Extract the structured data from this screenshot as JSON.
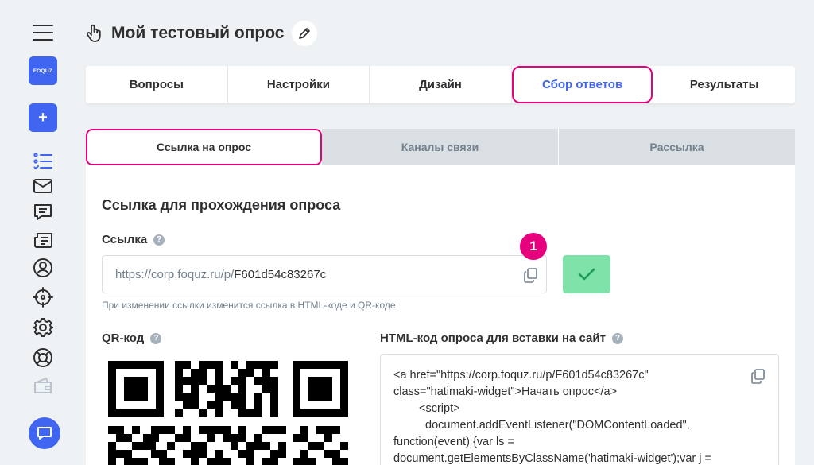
{
  "app": {
    "logo_text": "FOQUZ"
  },
  "sidebar": {
    "add_label": "+",
    "items": [
      {
        "icon": "checklist-icon"
      },
      {
        "icon": "mail-icon"
      },
      {
        "icon": "message-icon"
      },
      {
        "icon": "newspaper-icon"
      },
      {
        "icon": "user-icon"
      },
      {
        "icon": "target-icon"
      },
      {
        "icon": "gear-icon"
      },
      {
        "icon": "lifebuoy-icon"
      },
      {
        "icon": "wallet-icon"
      }
    ]
  },
  "header": {
    "title": "Мой тестовый опрос"
  },
  "main_tabs": [
    {
      "label": "Вопросы"
    },
    {
      "label": "Настройки"
    },
    {
      "label": "Дизайн"
    },
    {
      "label": "Сбор ответов"
    },
    {
      "label": "Результаты"
    }
  ],
  "sub_tabs": [
    {
      "label": "Ссылка на опрос"
    },
    {
      "label": "Каналы связи"
    },
    {
      "label": "Рассылка"
    }
  ],
  "content": {
    "section_title": "Ссылка для прохождения опроса",
    "link_label": "Ссылка",
    "link_prefix": "https://corp.foquz.ru/p/",
    "link_suffix": "F601d54c83267c",
    "badge": "1",
    "hint": "При изменении ссылки изменится ссылка в HTML-коде и QR-коде",
    "qr_label": "QR-код",
    "html_label": "HTML-код опроса для вставки на сайт",
    "code_lines": [
      "<a href=\"https://corp.foquz.ru/p/F601d54c83267c\"",
      "class=\"hatimaki-widget\">Начать опрос</a>",
      "<script>",
      "document.addEventListener(\"DOMContentLoaded\",",
      "function(event) {var ls =",
      "document.getElementsByClassName('hatimaki-widget');var j ="
    ]
  },
  "colors": {
    "accent": "#3f65f1",
    "highlight": "#e6007e",
    "success": "#7fe2a9"
  }
}
